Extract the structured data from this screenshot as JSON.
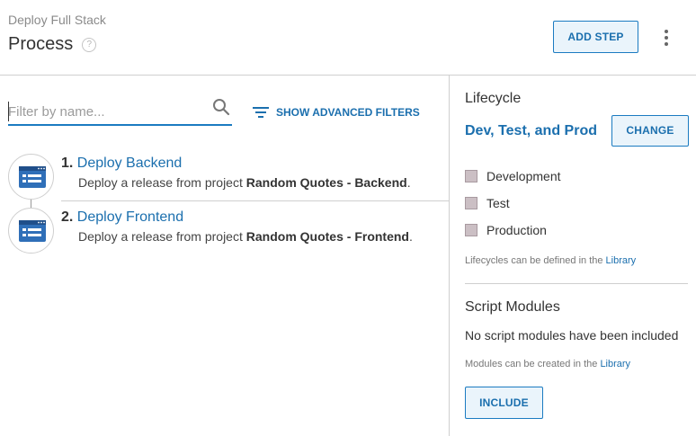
{
  "header": {
    "breadcrumb": "Deploy Full Stack",
    "title": "Process",
    "help_icon": "?",
    "add_step_label": "ADD STEP",
    "more_icon": "more-vertical-icon"
  },
  "filter": {
    "placeholder": "Filter by name...",
    "value": "",
    "advanced_label": "SHOW ADVANCED FILTERS"
  },
  "steps": [
    {
      "number": "1.",
      "name": "Deploy Backend",
      "desc_prefix": "Deploy a release from project ",
      "project": "Random Quotes - Backend",
      "desc_suffix": "."
    },
    {
      "number": "2.",
      "name": "Deploy Frontend",
      "desc_prefix": "Deploy a release from project ",
      "project": "Random Quotes - Frontend",
      "desc_suffix": "."
    }
  ],
  "sidebar": {
    "lifecycle_heading": "Lifecycle",
    "lifecycle_name": "Dev, Test, and Prod",
    "change_label": "CHANGE",
    "phases": [
      "Development",
      "Test",
      "Production"
    ],
    "lifecycle_note": "Lifecycles can be defined in the ",
    "lifecycle_note_link": "Library",
    "script_heading": "Script Modules",
    "no_modules": "No script modules have been included",
    "modules_note": "Modules can be created in the ",
    "modules_note_link": "Library",
    "include_label": "INCLUDE"
  },
  "colors": {
    "accent": "#1b6fae",
    "button_bg": "#eaf4fb",
    "phase_square": "#cbbfc4",
    "step_icon": "#2f6fb8"
  }
}
